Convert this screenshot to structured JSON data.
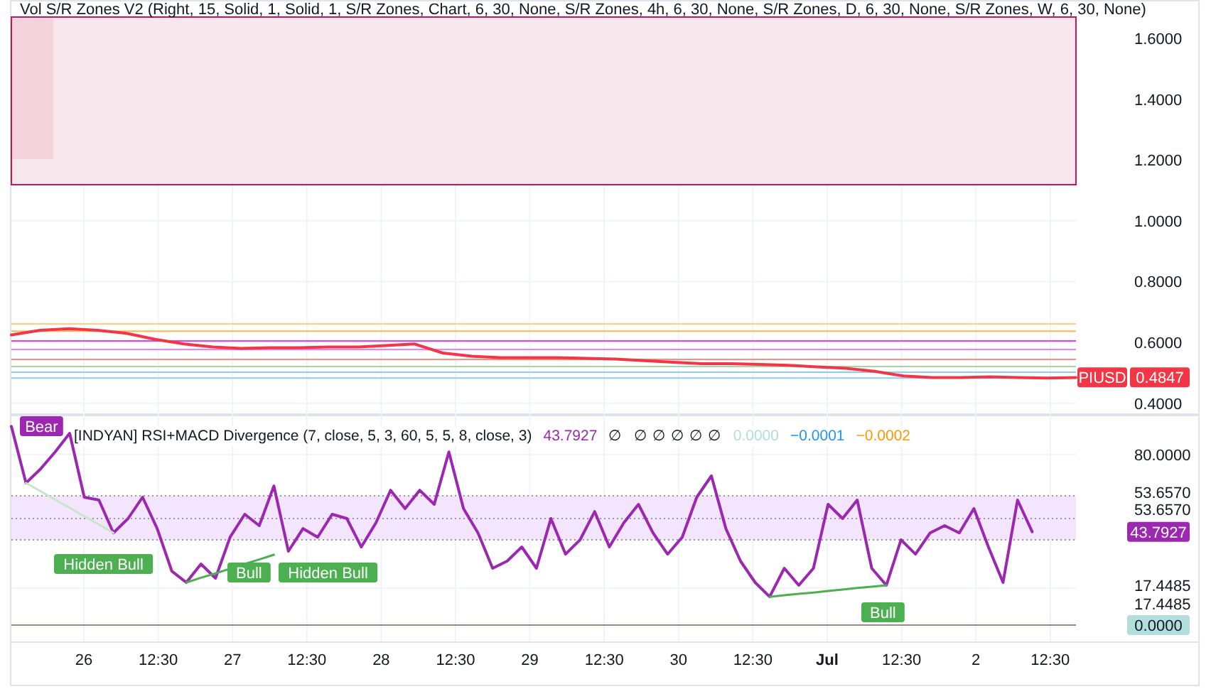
{
  "price_panel": {
    "legend": "Vol S/R Zones V2 (Right, 15, Solid, 1, Solid, 1, S/R Zones, Chart, 6, 30, None, S/R Zones, 4h, 6, 30, None, S/R Zones, D, 6, 30, None, S/R Zones, W, 6, 30, None)",
    "price_tag": "0.4847",
    "chart_data": {
      "type": "line",
      "grid": true,
      "ylim": [
        0.362,
        1.67
      ],
      "series": [
        {
          "name": "PIUSD",
          "color": "#f23645",
          "values": [
            0.625,
            0.64,
            0.645,
            0.64,
            0.63,
            0.61,
            0.595,
            0.585,
            0.58,
            0.583,
            0.583,
            0.585,
            0.585,
            0.59,
            0.595,
            0.565,
            0.555,
            0.55,
            0.55,
            0.55,
            0.548,
            0.545,
            0.54,
            0.535,
            0.53,
            0.53,
            0.528,
            0.525,
            0.52,
            0.515,
            0.505,
            0.49,
            0.485,
            0.485,
            0.487,
            0.485,
            0.483,
            0.485
          ]
        }
      ],
      "yticks": [
        {
          "value": 1.6,
          "label": "1.6000"
        },
        {
          "value": 1.4,
          "label": "1.4000"
        },
        {
          "value": 1.2,
          "label": "1.2000"
        },
        {
          "value": 1.0,
          "label": "1.0000"
        },
        {
          "value": 0.8,
          "label": "0.8000"
        },
        {
          "value": 0.6,
          "label": "0.6000"
        },
        {
          "value": 0.4,
          "label": "0.4000"
        }
      ],
      "ref_lines": [
        {
          "axis": "y",
          "value": 0.661,
          "color": "#ffcc80"
        },
        {
          "axis": "y",
          "value": 0.637,
          "color": "#ffb74d"
        },
        {
          "axis": "y",
          "value": 0.605,
          "color": "#e040fb"
        },
        {
          "axis": "y",
          "value": 0.577,
          "color": "#ea80fc"
        },
        {
          "axis": "y",
          "value": 0.544,
          "color": "#ff8a80"
        },
        {
          "axis": "y",
          "value": 0.521,
          "color": "#a5d6a7"
        },
        {
          "axis": "y",
          "value": 0.502,
          "color": "#90caf9"
        },
        {
          "axis": "y",
          "value": 0.483,
          "color": "#90caf9"
        }
      ]
    }
  },
  "rsi_panel": {
    "legend": "[INDYAN] RSI+MACD Divergence (7, close, 5, 3, 60, 5, 5, 8, close, 3)",
    "legend_values": [
      {
        "text": "43.7927",
        "color": "#9c27b0"
      },
      {
        "text": "∅",
        "color": "#131722"
      },
      {
        "text": "∅ ∅ ∅ ∅ ∅",
        "color": "#131722"
      },
      {
        "text": "0.0000",
        "color": "#b2dfdb"
      },
      {
        "text": "−0.0001",
        "color": "#2196f3"
      },
      {
        "text": "−0.0002",
        "color": "#ff9800"
      }
    ],
    "extra_axis_labels": [
      "53.6570",
      "17.4485"
    ],
    "axis_tags": [
      {
        "text": "43.7927",
        "color": "#9c27b0"
      },
      {
        "text": "0.0000",
        "color": "#b2dfdb"
      }
    ],
    "signals": [
      {
        "text": "Bear",
        "kind": "bear"
      },
      {
        "text": "Hidden Bull",
        "kind": "bull"
      },
      {
        "text": "Bull",
        "kind": "bull"
      },
      {
        "text": "Hidden Bull",
        "kind": "bull"
      },
      {
        "text": "Bull",
        "kind": "bull"
      }
    ],
    "chart_data": {
      "type": "line",
      "grid": true,
      "ylim": [
        -8,
        98.7
      ],
      "series": [
        {
          "color": "#9c27b0",
          "values": [
            93.3,
            66.7,
            73.3,
            81.3,
            90,
            60,
            58.7,
            43.3,
            50,
            60,
            45.3,
            25.3,
            20,
            28.7,
            22,
            41.3,
            52,
            46.7,
            65.3,
            34.7,
            45.3,
            41.3,
            52,
            50,
            36.7,
            48,
            63.3,
            54.7,
            63.3,
            56.7,
            81.3,
            54.7,
            43.3,
            26.7,
            30,
            36.7,
            26.7,
            50,
            33.3,
            40,
            53.3,
            36.7,
            48,
            56.7,
            43.3,
            33.3,
            41.3,
            60,
            70,
            45.3,
            30,
            20,
            13.3,
            26.7,
            18.7,
            26.7,
            56.7,
            50,
            58.7,
            26.7,
            18.7,
            40,
            33.3,
            43.3,
            46.7,
            43.3,
            54.7,
            36.7,
            20,
            58.7,
            43.8
          ]
        },
        {
          "color": "#c8e6c9",
          "values": [
            null,
            66.7,
            62.8,
            58.9,
            55,
            51.1,
            47.2,
            43.3,
            null,
            null,
            null,
            null,
            null,
            null,
            null,
            null,
            null,
            null,
            null,
            null,
            null,
            null,
            null,
            null,
            null,
            null,
            null,
            null,
            null,
            null,
            null,
            null,
            null,
            null,
            null,
            null,
            null,
            null,
            null,
            null,
            null,
            null,
            null,
            null,
            null,
            null,
            null,
            null,
            null,
            null,
            null,
            null,
            null,
            null,
            null,
            null,
            null,
            null,
            null,
            null,
            null,
            null,
            null,
            null,
            null,
            null,
            null,
            null,
            null,
            null,
            null
          ]
        },
        {
          "color": "#4caf50",
          "values": [
            null,
            null,
            null,
            null,
            null,
            null,
            null,
            null,
            null,
            null,
            null,
            null,
            20,
            22.2,
            24.3,
            26.5,
            28.7,
            30.8,
            33,
            null,
            null,
            null,
            null,
            null,
            null,
            null,
            null,
            null,
            null,
            null,
            null,
            null,
            null,
            null,
            null,
            null,
            null,
            null,
            null,
            null,
            null,
            null,
            null,
            null,
            null,
            null,
            null,
            null,
            null,
            null,
            null,
            null,
            13.3,
            14,
            14.7,
            15.3,
            16,
            16.7,
            17.4,
            18,
            18.7,
            null,
            null,
            null,
            null,
            null,
            null,
            null,
            null,
            null,
            null
          ]
        }
      ],
      "yticks": [
        {
          "value": 80,
          "label": "80.0000"
        },
        {
          "value": 53.657,
          "label": "53.6570"
        },
        {
          "value": 17.4485,
          "label": "17.4485"
        }
      ],
      "bands": [
        {
          "axis": "y",
          "from": 40,
          "to": 60.7,
          "color": "#f3e5fd"
        }
      ]
    },
    "time_axis": [
      {
        "label": "26",
        "bold": false
      },
      {
        "label": "12:30",
        "bold": false
      },
      {
        "label": "27",
        "bold": false
      },
      {
        "label": "12:30",
        "bold": false
      },
      {
        "label": "28",
        "bold": false
      },
      {
        "label": "12:30",
        "bold": false
      },
      {
        "label": "29",
        "bold": false
      },
      {
        "label": "12:30",
        "bold": false
      },
      {
        "label": "30",
        "bold": false
      },
      {
        "label": "12:30",
        "bold": false
      },
      {
        "label": "Jul",
        "bold": true
      },
      {
        "label": "12:30",
        "bold": false
      },
      {
        "label": "2",
        "bold": false
      },
      {
        "label": "12:30",
        "bold": false
      }
    ]
  }
}
